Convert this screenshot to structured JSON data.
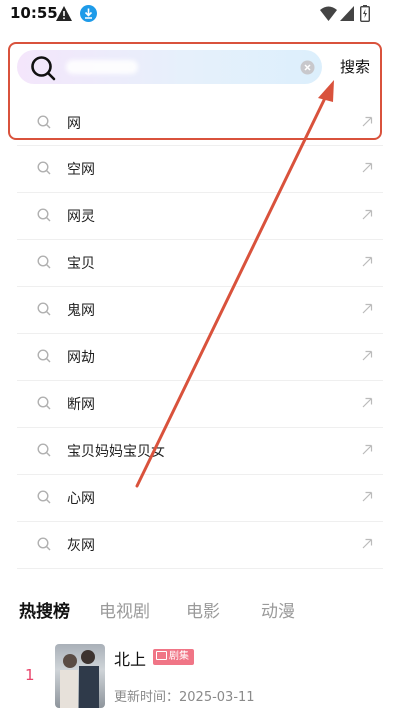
{
  "status_bar": {
    "time": "10:55",
    "icons": [
      "warning-icon",
      "download-icon",
      "wifi-icon",
      "signal-icon",
      "battery-icon"
    ]
  },
  "search": {
    "value": "",
    "placeholder": "",
    "button_label": "搜索"
  },
  "suggestions": [
    {
      "label": "网"
    },
    {
      "label": "空网"
    },
    {
      "label": "网灵"
    },
    {
      "label": "宝贝"
    },
    {
      "label": "鬼网"
    },
    {
      "label": "网劫"
    },
    {
      "label": "断网"
    },
    {
      "label": "宝贝妈妈宝贝女"
    },
    {
      "label": "心网"
    },
    {
      "label": "灰网"
    }
  ],
  "tabs": [
    {
      "label": "热搜榜",
      "active": true
    },
    {
      "label": "电视剧",
      "active": false
    },
    {
      "label": "电影",
      "active": false
    },
    {
      "label": "动漫",
      "active": false
    }
  ],
  "hot_list": [
    {
      "rank": "1",
      "title": "北上",
      "badge": "剧集",
      "update_label": "更新时间：",
      "update_date": "2025-03-11"
    }
  ],
  "colors": {
    "annotation": "#d9523c",
    "rank": "#e8456b",
    "badge": "#f07586"
  }
}
